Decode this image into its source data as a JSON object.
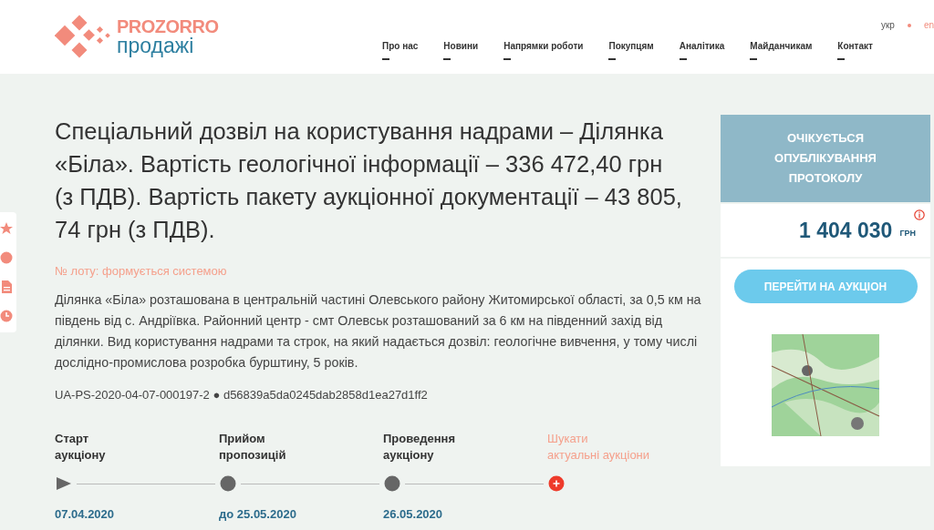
{
  "header": {
    "logo": {
      "brand": "PROZORRO",
      "product": "продажі"
    },
    "nav": [
      {
        "label": "Про нас"
      },
      {
        "label": "Новини"
      },
      {
        "label": "Напрямки роботи"
      },
      {
        "label": "Покупцям"
      },
      {
        "label": "Аналітика"
      },
      {
        "label": "Майданчикам"
      },
      {
        "label": "Контакт"
      }
    ],
    "languages": [
      {
        "label": "укр",
        "selected": true
      },
      {
        "label": "en",
        "selected": false
      }
    ]
  },
  "lot": {
    "title": "Спеціальний дозвіл на користування надрами – Ділянка «Біла». Вартість геологічної інформації – 336 472,40 грн (з ПДВ). Вартість пакету аукціонної документації – 43 805, 74 грн (з ПДВ).",
    "lot_number": "№ лоту: формується системою",
    "description": "Ділянка «Біла» розташована в центральній частині Олевського району Житомирської області, за 0,5 км на південь від с. Андріївка. Районний центр - смт Олевськ розташований за 6 км на південний захід від ділянки. Вид користування надрами та строк, на який надається дозвіл: геологічне вивчення, у тому числі дослідно-промислова розробка бурштину, 5 років.",
    "ids": "UA-PS-2020-04-07-000197-2 ● d56839a5da0245dab2858d1ea27d1ff2"
  },
  "timeline": [
    {
      "kind": "start",
      "label": "Старт\nаукціону",
      "date": "07.04.2020"
    },
    {
      "kind": "stage",
      "label": "Прийом\nпропозицій",
      "date": "до 25.05.2020"
    },
    {
      "kind": "stage",
      "label": "Проведення\nаукціону",
      "date": "26.05.2020"
    },
    {
      "kind": "search",
      "label": "Шукати\nактуальні аукціони"
    }
  ],
  "auction_card": {
    "status": "ОЧІКУЄТЬСЯ ОПУБЛІКУВАННЯ ПРОТОКОЛУ",
    "price": "1 404 030",
    "currency": "ГРН",
    "button": "ПЕРЕЙТИ НА АУКЦІОН"
  }
}
